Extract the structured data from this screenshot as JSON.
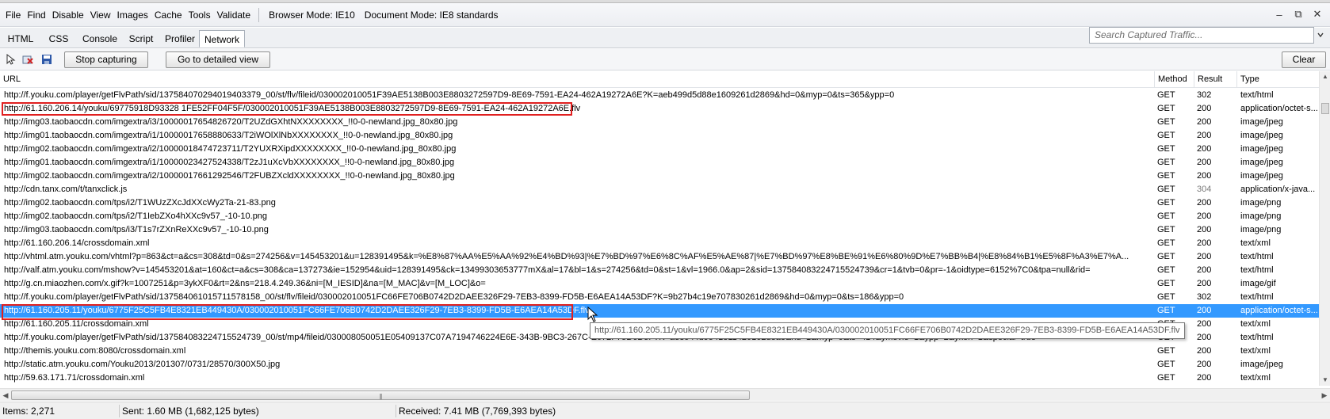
{
  "menubar": {
    "items": [
      "File",
      "Find",
      "Disable",
      "View",
      "Images",
      "Cache",
      "Tools",
      "Validate"
    ],
    "browser_mode": "Browser Mode: IE10",
    "document_mode": "Document Mode: IE8 standards"
  },
  "tabs": [
    "HTML",
    "CSS",
    "Console",
    "Script",
    "Profiler",
    "Network"
  ],
  "active_tab": "Network",
  "search": {
    "placeholder": "Search Captured Traffic..."
  },
  "toolbar": {
    "stop_capturing_label": "Stop capturing",
    "detailed_view_label": "Go to detailed view",
    "clear_label": "Clear"
  },
  "columns": {
    "url": "URL",
    "method": "Method",
    "result": "Result",
    "type": "Type"
  },
  "rows": [
    {
      "url": "http://f.youku.com/player/getFlvPath/sid/137584070294019403379_00/st/flv/fileid/030002010051F39AE5138B003E8803272597D9-8E69-7591-EA24-462A19272A6E?K=aeb499d5d88e1609261d2869&hd=0&myp=0&ts=365&ypp=0",
      "method": "GET",
      "result": "302",
      "type": "text/html"
    },
    {
      "url": "http://61.160.206.14/youku/69775918D93328 1FE52FF04F5F/030002010051F39AE5138B003E8803272597D9-8E69-7591-EA24-462A19272A6E.flv",
      "method": "GET",
      "result": "200",
      "type": "application/octet-s..."
    },
    {
      "url": "http://img03.taobaocdn.com/imgextra/i3/10000017654826720/T2UZdGXhtNXXXXXXXX_!!0-0-newland.jpg_80x80.jpg",
      "method": "GET",
      "result": "200",
      "type": "image/jpeg"
    },
    {
      "url": "http://img01.taobaocdn.com/imgextra/i1/10000017658880633/T2iWOlXlNbXXXXXXXX_!!0-0-newland.jpg_80x80.jpg",
      "method": "GET",
      "result": "200",
      "type": "image/jpeg"
    },
    {
      "url": "http://img02.taobaocdn.com/imgextra/i2/10000018474723711/T2YUXRXipdXXXXXXXX_!!0-0-newland.jpg_80x80.jpg",
      "method": "GET",
      "result": "200",
      "type": "image/jpeg"
    },
    {
      "url": "http://img01.taobaocdn.com/imgextra/i1/10000023427524338/T2zJ1uXcVbXXXXXXXX_!!0-0-newland.jpg_80x80.jpg",
      "method": "GET",
      "result": "200",
      "type": "image/jpeg"
    },
    {
      "url": "http://img02.taobaocdn.com/imgextra/i2/10000017661292546/T2FUBZXcldXXXXXXXX_!!0-0-newland.jpg_80x80.jpg",
      "method": "GET",
      "result": "200",
      "type": "image/jpeg"
    },
    {
      "url": "http://cdn.tanx.com/t/tanxclick.js",
      "method": "GET",
      "result": "304",
      "type": "application/x-java..."
    },
    {
      "url": "http://img02.taobaocdn.com/tps/i2/T1WUzZXcJdXXcWy2Ta-21-83.png",
      "method": "GET",
      "result": "200",
      "type": "image/png"
    },
    {
      "url": "http://img02.taobaocdn.com/tps/i2/T1IebZXo4hXXc9v57_-10-10.png",
      "method": "GET",
      "result": "200",
      "type": "image/png"
    },
    {
      "url": "http://img03.taobaocdn.com/tps/i3/T1s7rZXnReXXc9v57_-10-10.png",
      "method": "GET",
      "result": "200",
      "type": "image/png"
    },
    {
      "url": "http://61.160.206.14/crossdomain.xml",
      "method": "GET",
      "result": "200",
      "type": "text/xml"
    },
    {
      "url": "http://vhtml.atm.youku.com/vhtml?p=863&ct=a&cs=308&td=0&s=274256&v=145453201&u=128391495&k=%E8%87%AA%E5%AA%92%E4%BD%93|%E7%BD%97%E6%8C%AF%E5%AE%87|%E7%BD%97%E8%BE%91%E6%80%9D%E7%BB%B4|%E8%84%B1%E5%8F%A3%E7%A...",
      "method": "GET",
      "result": "200",
      "type": "text/html"
    },
    {
      "url": "http://valf.atm.youku.com/mshow?v=145453201&at=160&ct=a&cs=308&ca=137273&ie=152954&uid=128391495&ck=13499303653777mX&al=17&bl=1&s=274256&td=0&st=1&vl=1966.0&ap=2&sid=137584083224715524739&cr=1&tvb=0&pr=-1&oidtype=6152%7C0&tpa=null&rid=",
      "method": "GET",
      "result": "200",
      "type": "text/html"
    },
    {
      "url": "http://g.cn.miaozhen.com/x.gif?k=1007251&p=3ykXF0&rt=2&ns=218.4.249.36&ni=[M_IESID]&na=[M_MAC]&v=[M_LOC]&o=",
      "method": "GET",
      "result": "200",
      "type": "image/gif"
    },
    {
      "url": "http://f.youku.com/player/getFlvPath/sid/137584061015711578158_00/st/flv/fileid/030002010051FC66FE706B0742D2DAEE326F29-7EB3-8399-FD5B-E6AEA14A53DF?K=9b27b4c19e707830261d2869&hd=0&myp=0&ts=186&ypp=0",
      "method": "GET",
      "result": "302",
      "type": "text/html"
    },
    {
      "url": "http://61.160.205.11/youku/6775F25C5FB4E8321EB449430A/030002010051FC66FE706B0742D2DAEE326F29-7EB3-8399-FD5B-E6AEA14A53DF.flv",
      "method": "GET",
      "result": "200",
      "type": "application/octet-s..."
    },
    {
      "url": "http://61.160.205.11/crossdomain.xml",
      "method": "GET",
      "result": "200",
      "type": "text/xml"
    },
    {
      "url": "http://f.youku.com/player/getFlvPath/sid/137584083224715524739_00/st/mp4/fileid/030008050051E05409137C07A7194746224E6E-343B-9BC3-267C-E072F75D6D5F?K=ae8944d9541811420162d8a8&hd=1&myp=0&ts=414&ymovie=1&ypp=2&ykon=1&special=true",
      "method": "GET",
      "result": "200",
      "type": "text/html"
    },
    {
      "url": "http://themis.youku.com:8080/crossdomain.xml",
      "method": "GET",
      "result": "200",
      "type": "text/xml"
    },
    {
      "url": "http://static.atm.youku.com/Youku2013/201307/0731/28570/300X50.jpg",
      "method": "GET",
      "result": "200",
      "type": "image/jpeg"
    },
    {
      "url": "http://59.63.171.71/crossdomain.xml",
      "method": "GET",
      "result": "200",
      "type": "text/xml"
    }
  ],
  "selected_row": 16,
  "tooltip": "http://61.160.205.11/youku/6775F25C5FB4E8321EB449430A/030002010051FC66FE706B0742D2DAEE326F29-7EB3-8399-FD5B-E6AEA14A53DF.flv",
  "status": {
    "items": "Items: 2,271",
    "sent": "Sent: 1.60 MB (1,682,125 bytes)",
    "received": "Received: 7.41 MB (7,769,393 bytes)"
  },
  "colors": {
    "selection": "#3399ff",
    "highlight_outline": "#e02020",
    "dim_result": "#7a7a7a"
  },
  "icons": [
    "select-element-icon",
    "clear-cache-icon",
    "save-icon",
    "search-icon",
    "minimize-icon",
    "restore-icon",
    "close-icon"
  ]
}
